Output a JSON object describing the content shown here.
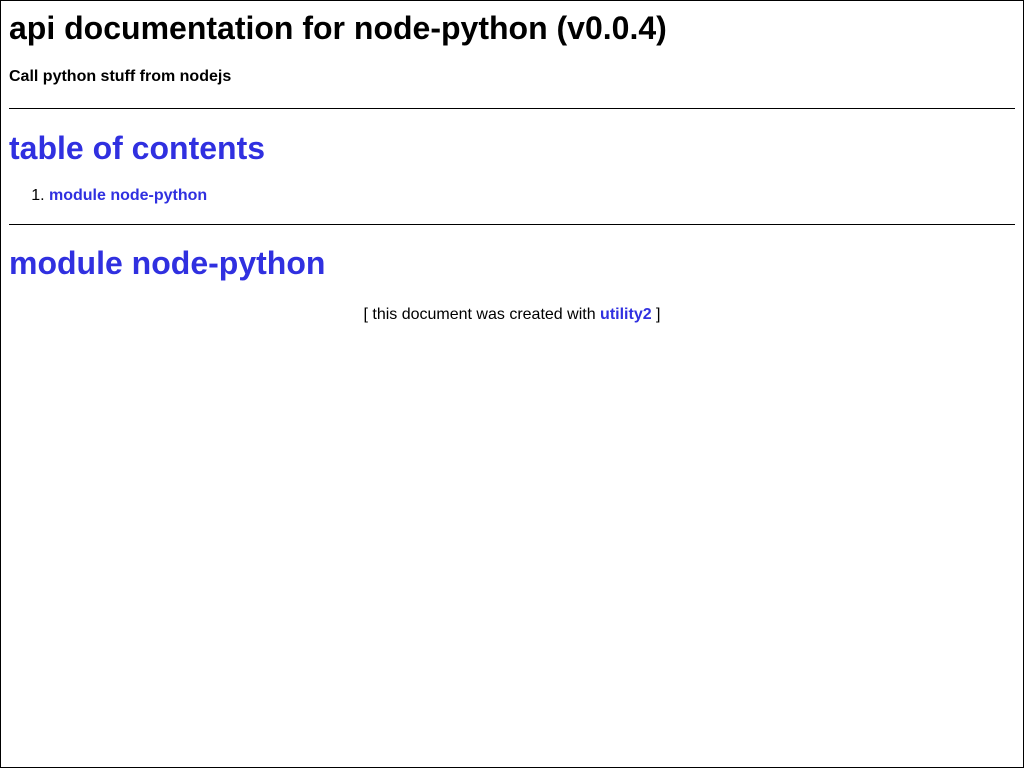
{
  "header": {
    "title": "api documentation for node-python (v0.0.4)",
    "description": "Call python stuff from nodejs"
  },
  "toc": {
    "title": "table of contents",
    "items": [
      {
        "number": "1.",
        "label": "module node-python"
      }
    ]
  },
  "module": {
    "title": "module node-python"
  },
  "footer": {
    "prefix": "[ this document was created with ",
    "link_label": "utility2",
    "suffix": " ]"
  },
  "colors": {
    "link": "#3030e0",
    "text": "#000000",
    "background": "#ffffff"
  }
}
